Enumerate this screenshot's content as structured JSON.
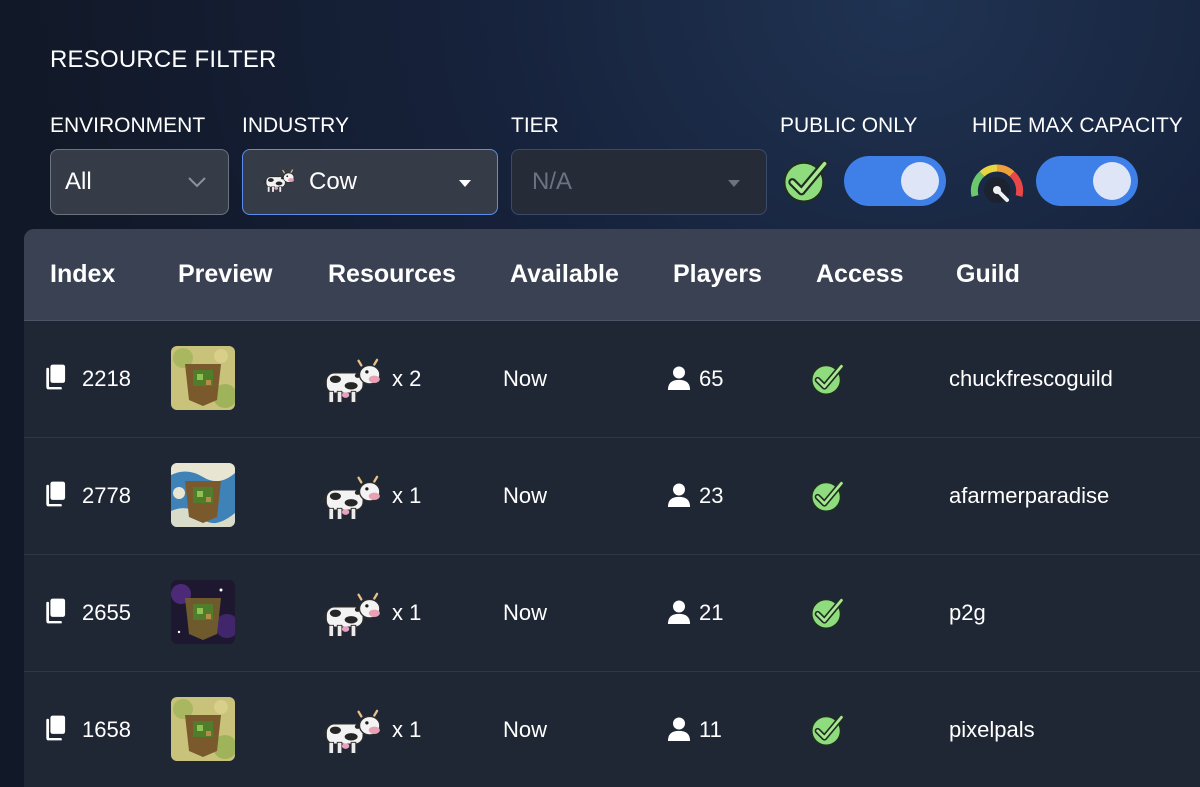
{
  "filter": {
    "title": "RESOURCE FILTER",
    "environment": {
      "label": "ENVIRONMENT",
      "value": "All"
    },
    "industry": {
      "label": "INDUSTRY",
      "value": "Cow"
    },
    "tier": {
      "label": "TIER",
      "value": "N/A"
    },
    "public_only": {
      "label": "PUBLIC ONLY",
      "enabled": true
    },
    "hide_max_capacity": {
      "label": "HIDE MAX CAPACITY",
      "enabled": true
    }
  },
  "table": {
    "headers": [
      "Index",
      "Preview",
      "Resources",
      "Available",
      "Players",
      "Access",
      "Guild"
    ],
    "rows": [
      {
        "index": "2218",
        "preview": "grassland",
        "resources": "x 2",
        "available": "Now",
        "players": "65",
        "access": "public",
        "guild": "chuckfrescoguild"
      },
      {
        "index": "2778",
        "preview": "ocean",
        "resources": "x 1",
        "available": "Now",
        "players": "23",
        "access": "public",
        "guild": "afarmerparadise"
      },
      {
        "index": "2655",
        "preview": "space",
        "resources": "x 1",
        "available": "Now",
        "players": "21",
        "access": "public",
        "guild": "p2g"
      },
      {
        "index": "1658",
        "preview": "grassland",
        "resources": "x 1",
        "available": "Now",
        "players": "11",
        "access": "public",
        "guild": "pixelpals"
      }
    ]
  },
  "colors": {
    "accent": "#3f7fe8",
    "check": "#86d977",
    "header_bg": "#394152",
    "row_bg": "#202734"
  },
  "icons": {
    "copy": "copy-icon",
    "player": "user-icon",
    "access": "check-icon",
    "resource": "cow-icon",
    "capacity": "gauge-icon"
  }
}
